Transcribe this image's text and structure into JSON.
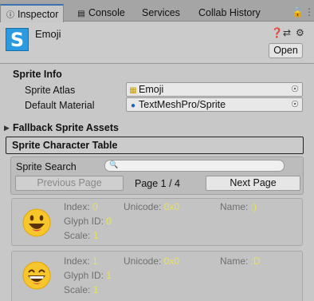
{
  "tabs": [
    {
      "label": "Inspector",
      "icon": "info-icon",
      "active": true
    },
    {
      "label": "Console",
      "icon": "console-icon",
      "active": false
    },
    {
      "label": "Services",
      "icon": "",
      "active": false
    },
    {
      "label": "Collab History",
      "icon": "",
      "active": false
    }
  ],
  "header": {
    "asset_icon_letter": "S",
    "asset_name": "Emoji",
    "open_label": "Open"
  },
  "sprite_info": {
    "title": "Sprite Info",
    "atlas_label": "Sprite Atlas",
    "atlas_value": "Emoji",
    "material_label": "Default Material",
    "material_value": "TextMeshPro/Sprite"
  },
  "fallback": {
    "title": "Fallback Sprite Assets"
  },
  "table": {
    "title": "Sprite Character Table",
    "search_label": "Sprite Search",
    "search_value": "",
    "prev_label": "Previous Page",
    "next_label": "Next Page",
    "page_text": "Page 1 / 4"
  },
  "field_labels": {
    "index": "Index:",
    "unicode": "Unicode:",
    "name": "Name:",
    "glyph_id": "Glyph ID:",
    "scale": "Scale:"
  },
  "characters": [
    {
      "index": "0",
      "unicode": "0x0",
      "name": ":)",
      "glyph_id": "0",
      "scale": "1"
    },
    {
      "index": "1",
      "unicode": "0x0",
      "name": ":D",
      "glyph_id": "1",
      "scale": "1"
    }
  ],
  "colors": {
    "accent": "#3a72b0",
    "value_text": "#e6e35a",
    "label_text": "#6f6f6f",
    "asset_icon_bg": "#2b9ae0"
  }
}
